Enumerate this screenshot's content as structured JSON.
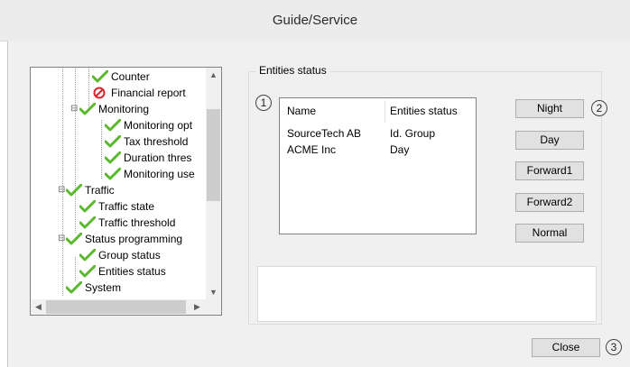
{
  "window": {
    "title": "Guide/Service"
  },
  "tree": {
    "items": [
      {
        "label": "Counter",
        "icon": "check-icon",
        "level": 3
      },
      {
        "label": "Financial report",
        "icon": "prohibited-icon",
        "level": 3
      },
      {
        "label": "Monitoring",
        "icon": "check-icon",
        "level": 2,
        "expander": "⊟"
      },
      {
        "label": "Monitoring opt",
        "icon": "check-icon",
        "level": 4
      },
      {
        "label": "Tax threshold",
        "icon": "check-icon",
        "level": 4
      },
      {
        "label": "Duration thres",
        "icon": "check-icon",
        "level": 4
      },
      {
        "label": "Monitoring use",
        "icon": "check-icon",
        "level": 4
      },
      {
        "label": "Traffic",
        "icon": "check-icon",
        "level": 1,
        "expander": "⊟"
      },
      {
        "label": "Traffic state",
        "icon": "check-icon",
        "level": 2
      },
      {
        "label": "Traffic threshold",
        "icon": "check-icon",
        "level": 2
      },
      {
        "label": "Status programming",
        "icon": "check-icon",
        "level": 1,
        "expander": "⊟"
      },
      {
        "label": "Group status",
        "icon": "check-icon",
        "level": 2
      },
      {
        "label": "Entities status",
        "icon": "check-icon",
        "level": 2
      },
      {
        "label": "System",
        "icon": "check-icon",
        "level": 1
      }
    ]
  },
  "entities": {
    "group_label": "Entities status",
    "columns": [
      "Name",
      "Entities status"
    ],
    "rows": [
      [
        "SourceTech AB",
        "Id. Group"
      ],
      [
        "ACME Inc",
        "Day"
      ]
    ]
  },
  "buttons": {
    "night": "Night",
    "day": "Day",
    "forward1": "Forward1",
    "forward2": "Forward2",
    "normal": "Normal",
    "close": "Close"
  },
  "badges": [
    "1",
    "2",
    "3"
  ],
  "colors": {
    "check": "#5cb82e",
    "prohibited": "#d9262c"
  }
}
